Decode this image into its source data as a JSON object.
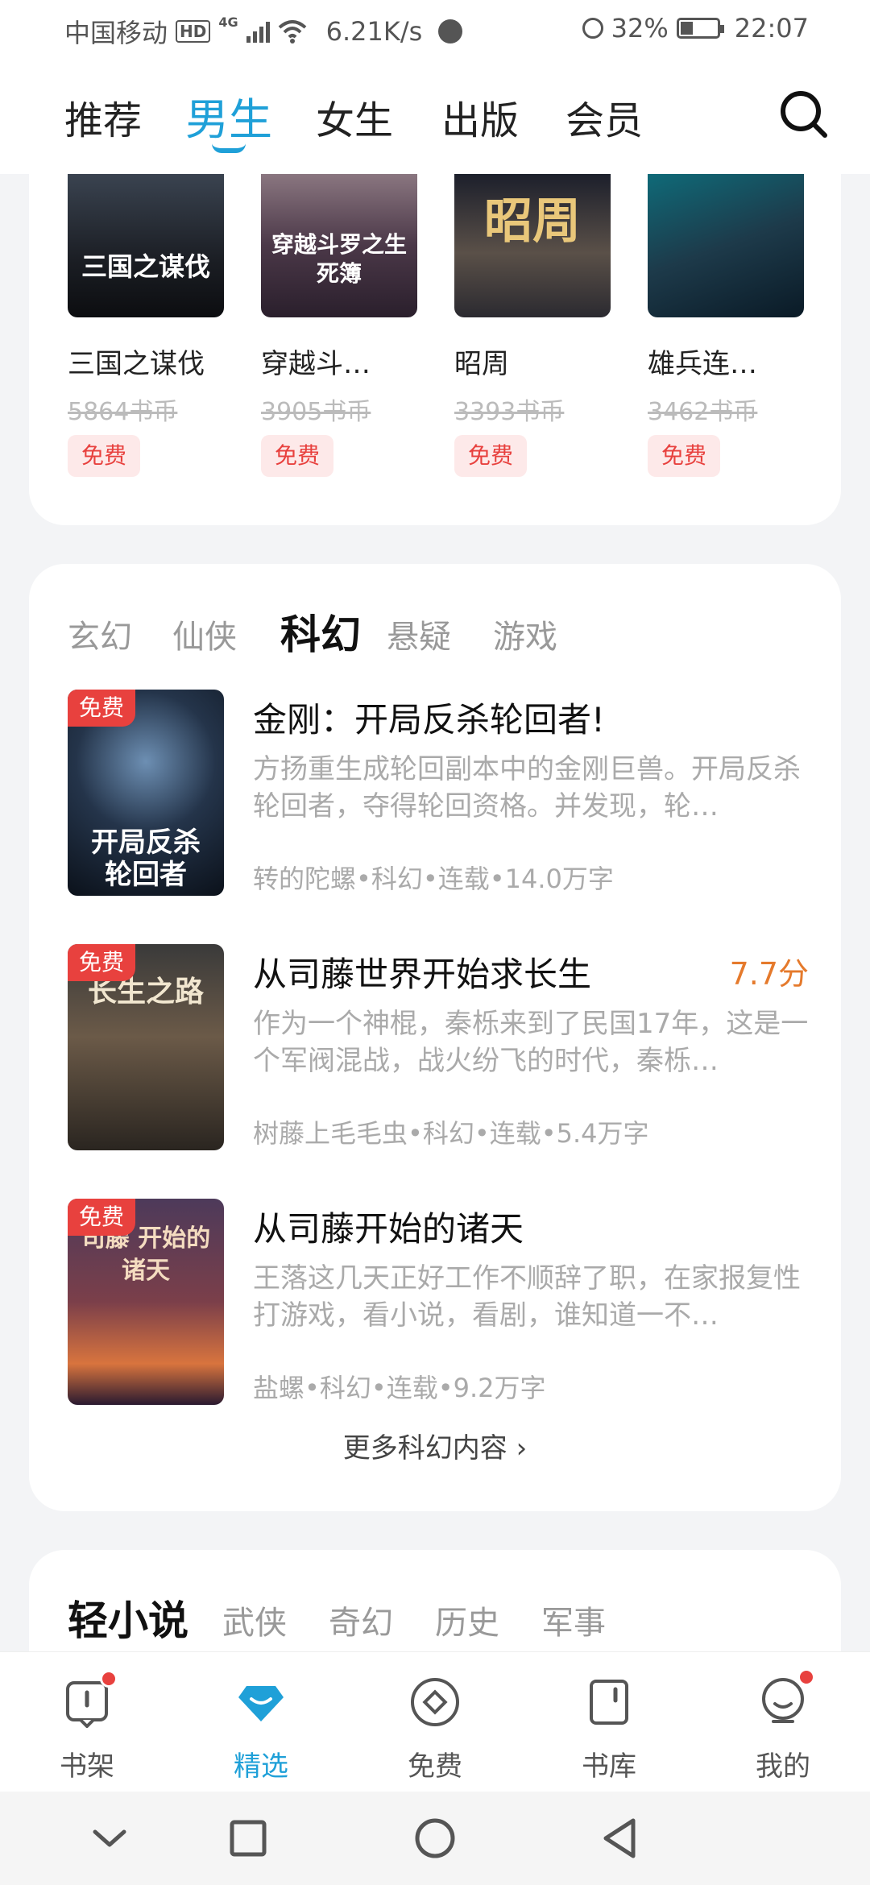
{
  "status_bar": {
    "carrier": "中国移动",
    "hd": "HD",
    "network": "4G",
    "speed": "6.21K/s",
    "battery": "32%",
    "battery_level": 0.32,
    "time": "22:07"
  },
  "top_nav": {
    "tabs": [
      {
        "label": "推荐",
        "active": false
      },
      {
        "label": "男生",
        "active": true
      },
      {
        "label": "女生",
        "active": false
      },
      {
        "label": "出版",
        "active": false
      },
      {
        "label": "会员",
        "active": false
      }
    ],
    "search_icon": "search-icon",
    "accent_color": "#1fa0d8"
  },
  "free_books": [
    {
      "title": "三国之谋伐",
      "price": "5864书币",
      "badge": "免费",
      "cover_text": "三国之谋伐"
    },
    {
      "title": "穿越斗…",
      "price": "3905书币",
      "badge": "免费",
      "cover_text": "穿越斗罗之生死簿"
    },
    {
      "title": "昭周",
      "price": "3393书币",
      "badge": "免费",
      "cover_text": "昭周"
    },
    {
      "title": "雄兵连…",
      "price": "3462书币",
      "badge": "免费",
      "cover_text": ""
    }
  ],
  "genre_section": {
    "tabs": [
      {
        "label": "玄幻",
        "active": false
      },
      {
        "label": "仙侠",
        "active": false
      },
      {
        "label": "科幻",
        "active": true
      },
      {
        "label": "悬疑",
        "active": false
      },
      {
        "label": "游戏",
        "active": false
      }
    ],
    "items": [
      {
        "badge": "免费",
        "title": "金刚：开局反杀轮回者!",
        "score": "",
        "desc": "方扬重生成轮回副本中的金刚巨兽。开局反杀轮回者，夺得轮回资格。并发现，轮…",
        "meta": "转的陀螺•科幻•连载•14.0万字",
        "cover_text": "开局反杀轮回者"
      },
      {
        "badge": "免费",
        "title": "从司藤世界开始求长生",
        "score": "7.7分",
        "desc": "作为一个神棍，秦栎来到了民国17年，这是一个军阀混战，战火纷飞的时代，秦栎…",
        "meta": "树藤上毛毛虫•科幻•连载•5.4万字",
        "cover_text": "长生之路"
      },
      {
        "badge": "免费",
        "title": "从司藤开始的诸天",
        "score": "",
        "desc": "王落这几天正好工作不顺辞了职，在家报复性打游戏，看小说，看剧，谁知道一不…",
        "meta": "盐螺•科幻•连载•9.2万字",
        "cover_text": "司藤 开始的诸天"
      }
    ],
    "more_label": "更多科幻内容 ›"
  },
  "light_novel_section": {
    "tabs": [
      {
        "label": "轻小说",
        "active": true
      },
      {
        "label": "武侠",
        "active": false
      },
      {
        "label": "奇幻",
        "active": false
      },
      {
        "label": "历史",
        "active": false
      },
      {
        "label": "军事",
        "active": false
      }
    ]
  },
  "bottom_nav": {
    "items": [
      {
        "label": "书架",
        "icon": "bookshelf-icon",
        "active": false,
        "dot": true
      },
      {
        "label": "精选",
        "icon": "diamond-icon",
        "active": true,
        "dot": false
      },
      {
        "label": "免费",
        "icon": "free-icon",
        "active": false,
        "dot": false
      },
      {
        "label": "书库",
        "icon": "library-icon",
        "active": false,
        "dot": false
      },
      {
        "label": "我的",
        "icon": "profile-icon",
        "active": false,
        "dot": true
      }
    ]
  }
}
